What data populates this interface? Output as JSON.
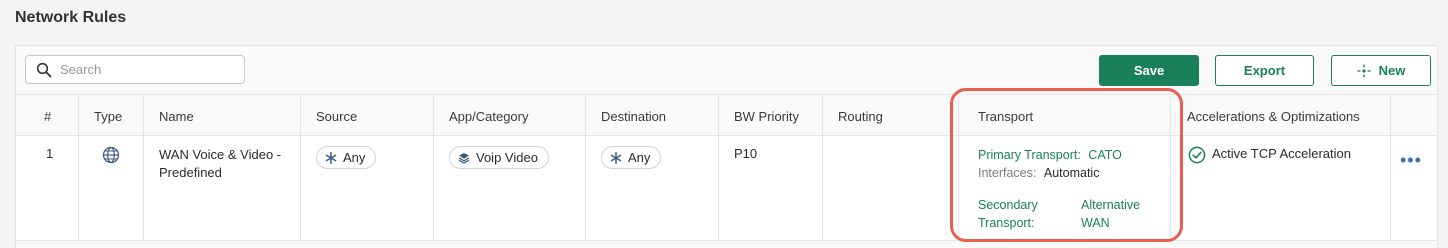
{
  "page": {
    "title": "Network Rules"
  },
  "toolbar": {
    "search_placeholder": "Search",
    "save_label": "Save",
    "export_label": "Export",
    "new_label": "New"
  },
  "columns": [
    "#",
    "Type",
    "Name",
    "Source",
    "App/Category",
    "Destination",
    "BW Priority",
    "Routing",
    "Transport",
    "Accelerations & Optimizations"
  ],
  "rows": [
    {
      "index": "1",
      "type_icon": "globe-icon",
      "name": "WAN Voice & Video - Predefined",
      "source": "Any",
      "app_category": "Voip Video",
      "destination": "Any",
      "bw_priority": "P10",
      "routing": "",
      "transport": {
        "primary_label": "Primary Transport:",
        "primary_value": "CATO",
        "interfaces_label": "Interfaces:",
        "interfaces_value": "Automatic",
        "secondary_label_1": "Secondary",
        "secondary_label_2": "Transport:",
        "secondary_value_1": "Alternative",
        "secondary_value_2": "WAN"
      },
      "acceleration": "Active TCP Acceleration"
    }
  ],
  "colors": {
    "accent": "#19805a",
    "highlight": "#e85f52",
    "link": "#3d6fb6"
  }
}
